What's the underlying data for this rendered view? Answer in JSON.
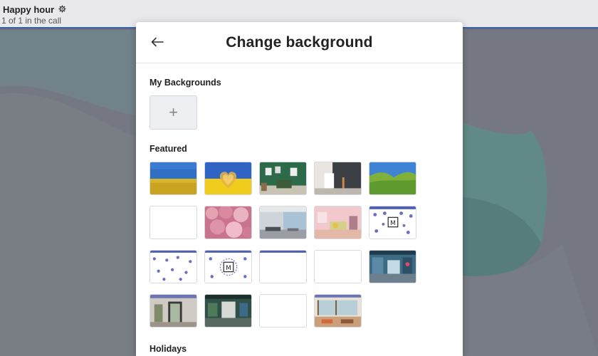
{
  "meeting": {
    "title": "Happy hour",
    "participants": "1 of 1 in the call"
  },
  "modal": {
    "title": "Change background",
    "my_backgrounds_label": "My Backgrounds",
    "add_symbol": "+",
    "featured_label": "Featured",
    "holidays_label": "Holidays"
  },
  "colors": {
    "accent": "#3b5fa8",
    "overlay": "#737680"
  },
  "icons": {
    "back": "arrow-left-icon",
    "settings": "gear-icon",
    "add": "plus-icon"
  },
  "featured_backgrounds": [
    "wheat-field-blue-sky",
    "ukraine-heart-flag",
    "green-gallery-room",
    "dark-studio-room",
    "green-hills-blue-sky",
    "blank-white",
    "pink-blossoms",
    "modern-lounge",
    "pink-playroom",
    "snowflake-pattern-logo",
    "snowflake-pattern",
    "snowflake-pattern-logo-2",
    "blank-with-blue-stripe",
    "blank-white-2",
    "arcade-room",
    "doorway-room",
    "green-office",
    "blank-white-3",
    "cafe-interior"
  ]
}
